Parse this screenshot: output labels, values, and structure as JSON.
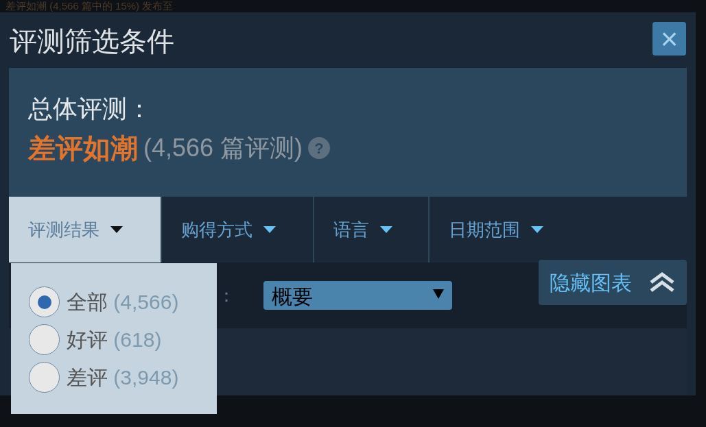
{
  "background_text": "差评如潮 (4,566 篇中的 15%) 发布至",
  "dialog": {
    "title": "评测筛选条件",
    "close": "×"
  },
  "summary": {
    "label": "总体评测：",
    "rating": "差评如潮",
    "count": "(4,566 篇评测)",
    "help": "?"
  },
  "filters": [
    {
      "label": "评测结果",
      "selected": true
    },
    {
      "label": "购得方式",
      "selected": false
    },
    {
      "label": "语言",
      "selected": false
    },
    {
      "label": "日期范围",
      "selected": false
    }
  ],
  "display": {
    "label": "：",
    "value": "概要"
  },
  "hide_chart": {
    "label": "隐藏图表"
  },
  "menu": [
    {
      "label": "全部",
      "count": "(4,566)",
      "selected": true
    },
    {
      "label": "好评",
      "count": "(618)",
      "selected": false
    },
    {
      "label": "差评",
      "count": "(3,948)",
      "selected": false
    }
  ]
}
